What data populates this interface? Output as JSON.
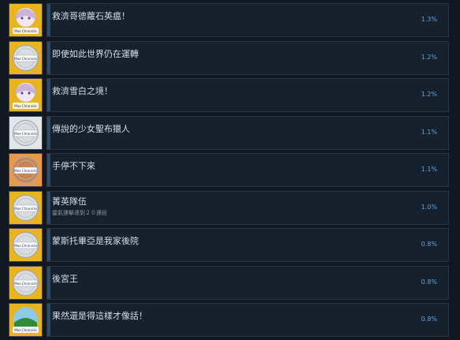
{
  "achievements": [
    {
      "title": "救濟哥德蘿石英瘟！",
      "description": "",
      "percent": "1.3%",
      "icon": "girl-portrait-icon",
      "tier": "gold",
      "fg": "#d9c8e3"
    },
    {
      "title": "即使如此世界仍在運轉",
      "description": "",
      "percent": "1.2%",
      "icon": "silver-coin-icon",
      "tier": "gold",
      "fg": "#d8dcde"
    },
    {
      "title": "救濟雪白之境！",
      "description": "",
      "percent": "1.2%",
      "icon": "girl-portrait-icon",
      "tier": "gold",
      "fg": "#d9c8e3"
    },
    {
      "title": "傳說的少女聖布獵人",
      "description": "",
      "percent": "1.1%",
      "icon": "silver-coin-icon",
      "tier": "silver",
      "fg": "#d8dcde"
    },
    {
      "title": "手停不下來",
      "description": "",
      "percent": "1.1%",
      "icon": "bronze-coin-icon",
      "tier": "bronze",
      "fg": "#c98454"
    },
    {
      "title": "菁英隊伍",
      "description": "靈氣連擊達到２０連段",
      "percent": "1.0%",
      "icon": "silver-coin-icon",
      "tier": "gold",
      "fg": "#d8dcde"
    },
    {
      "title": "蒙斯托畢亞是我家後院",
      "description": "",
      "percent": "0.8%",
      "icon": "silver-coin-icon",
      "tier": "gold",
      "fg": "#d8dcde"
    },
    {
      "title": "後宮王",
      "description": "",
      "percent": "0.8%",
      "icon": "silver-coin-icon",
      "tier": "gold",
      "fg": "#d8dcde"
    },
    {
      "title": "果然還是得這樣才像話！",
      "description": "",
      "percent": "0.8%",
      "icon": "island-scene-icon",
      "tier": "gold",
      "fg": "#2f8a3a"
    }
  ],
  "colors": {
    "gold": "#e8b422",
    "silver": "#e2e6ea",
    "bronze": "#e89a4a",
    "percent": "#5fa4e0"
  },
  "logo_text": "Moe Chronicle"
}
